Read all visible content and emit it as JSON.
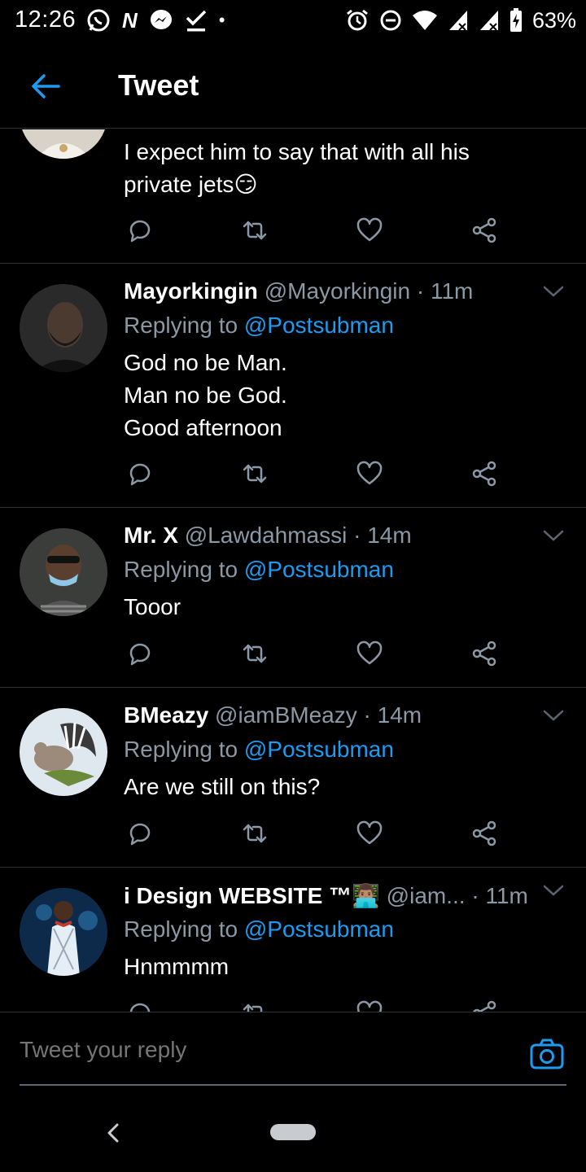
{
  "status_bar": {
    "time": "12:26",
    "left_icons": [
      "whatsapp-icon",
      "n-app-icon",
      "messenger-icon",
      "download-done-icon",
      "dot-icon"
    ],
    "right_icons": [
      "alarm-icon",
      "dnd-icon",
      "wifi-icon",
      "signal-icon",
      "signal-icon",
      "battery-charging-icon"
    ],
    "battery": "63%",
    "n_glyph": "N",
    "dot_glyph": "•"
  },
  "header": {
    "title": "Tweet",
    "back_icon": "arrow-left-icon",
    "accent": "#1d9bf0"
  },
  "tweets": [
    {
      "text_lines": [
        "I expect him to say that with all his",
        "private jets😏"
      ]
    },
    {
      "name": "Mayorkingin",
      "handle": "@Mayorkingin",
      "time": "· 11m",
      "replying_prefix": "Replying to ",
      "replying_to": "@Postsubman",
      "text_lines": [
        "God no be Man.",
        "Man no be God.",
        "Good afternoon"
      ]
    },
    {
      "name": "Mr. X",
      "handle": "@Lawdahmassi",
      "time": "· 14m",
      "replying_prefix": "Replying to ",
      "replying_to": "@Postsubman",
      "text_lines": [
        "Tooor"
      ]
    },
    {
      "name": "BMeazy",
      "handle": "@iamBMeazy",
      "time": "· 14m",
      "replying_prefix": "Replying to ",
      "replying_to": "@Postsubman",
      "text_lines": [
        "Are we still on this?"
      ]
    },
    {
      "name": "i Design WEBSITE ™👨🏽‍💻",
      "handle": "@iam...",
      "time": "· 11m",
      "replying_prefix": "Replying to ",
      "replying_to": "@Postsubman",
      "text_lines": [
        "Hnmmmm"
      ]
    }
  ],
  "action_icons": [
    "reply-icon",
    "retweet-icon",
    "like-icon",
    "share-icon"
  ],
  "composer": {
    "placeholder": "Tweet your reply",
    "camera_icon": "camera-icon"
  },
  "nav_bar": {
    "back_icon": "nav-back-icon",
    "home_icon": "home-pill-icon"
  },
  "colors": {
    "background": "#000000",
    "text": "#ffffff",
    "muted": "#8b98a5",
    "link": "#1d9bf0",
    "divider": "#2f3336"
  }
}
